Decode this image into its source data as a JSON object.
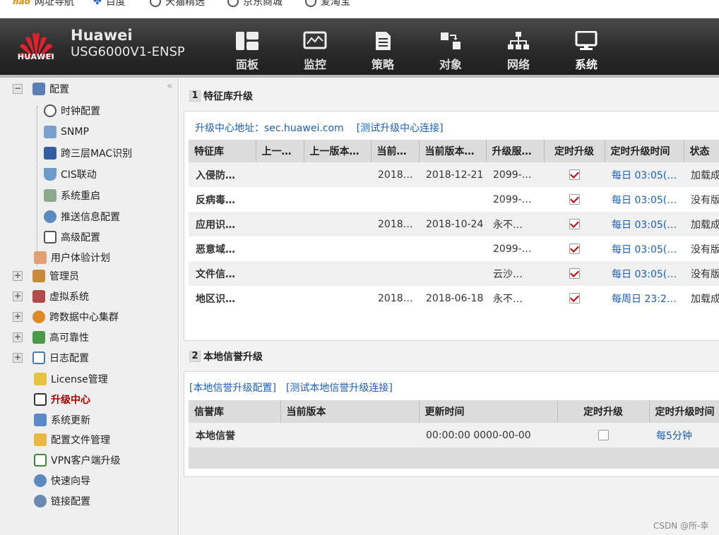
{
  "bookmarks": [
    "网址导航",
    "百度",
    "天猫精选",
    "京东商城",
    "爱淘宝"
  ],
  "header": {
    "logo_text": "HUAWEI",
    "brand": "Huawei",
    "model": "USG6000V1-ENSP",
    "nav": [
      {
        "label": "面板",
        "icon": "dashboard-icon"
      },
      {
        "label": "监控",
        "icon": "monitor-icon"
      },
      {
        "label": "策略",
        "icon": "policy-icon"
      },
      {
        "label": "对象",
        "icon": "object-icon"
      },
      {
        "label": "网络",
        "icon": "network-icon"
      },
      {
        "label": "系统",
        "icon": "system-icon",
        "active": true
      }
    ]
  },
  "sidebar": {
    "collapse_glyph": "«",
    "items": [
      {
        "label": "配置",
        "toggle": "−",
        "icon": "config-icon"
      },
      {
        "label": "时钟配置",
        "icon": "clock-icon"
      },
      {
        "label": "SNMP",
        "icon": "snmp-icon"
      },
      {
        "label": "跨三层MAC识别",
        "icon": "mac-icon"
      },
      {
        "label": "CIS联动",
        "icon": "cis-icon"
      },
      {
        "label": "系统重启",
        "icon": "restart-icon"
      },
      {
        "label": "推送信息配置",
        "icon": "push-icon"
      },
      {
        "label": "高级配置",
        "icon": "advanced-icon"
      },
      {
        "label": "用户体验计划",
        "icon": "ux-icon"
      },
      {
        "label": "管理员",
        "toggle": "+",
        "icon": "admin-icon"
      },
      {
        "label": "虚拟系统",
        "toggle": "+",
        "icon": "vsys-icon"
      },
      {
        "label": "跨数据中心集群",
        "toggle": "+",
        "icon": "cluster-icon"
      },
      {
        "label": "高可靠性",
        "toggle": "+",
        "icon": "ha-icon"
      },
      {
        "label": "日志配置",
        "toggle": "+",
        "icon": "log-icon"
      },
      {
        "label": "License管理",
        "icon": "license-icon"
      },
      {
        "label": "升级中心",
        "icon": "upgrade-icon",
        "active": true
      },
      {
        "label": "系统更新",
        "icon": "update-icon"
      },
      {
        "label": "配置文件管理",
        "icon": "file-icon"
      },
      {
        "label": "VPN客户端升级",
        "icon": "vpn-icon"
      },
      {
        "label": "快速向导",
        "icon": "wizard-icon"
      },
      {
        "label": "链接配置",
        "icon": "link-icon"
      }
    ]
  },
  "section1": {
    "num": "1",
    "title": "特征库升级",
    "center_label": "升级中心地址：sec.huawei.com",
    "test_link": "[测试升级中心连接]",
    "columns": [
      "特征库",
      "上一…",
      "上一版本…",
      "当前…",
      "当前版本…",
      "升级服…",
      "定时升级",
      "定时升级时间",
      "状态"
    ],
    "rows": [
      {
        "name": "入侵防…",
        "prev": "",
        "prev_date": "",
        "cur": "2018…",
        "cur_date": "2018-12-21",
        "svc": "2099-…",
        "sched": true,
        "time": "每日 03:05(…",
        "status": "加载成"
      },
      {
        "name": "反病毒…",
        "prev": "",
        "prev_date": "",
        "cur": "",
        "cur_date": "",
        "svc": "2099-…",
        "sched": true,
        "time": "每日 03:05(…",
        "status": "没有版"
      },
      {
        "name": "应用识…",
        "prev": "",
        "prev_date": "",
        "cur": "2018…",
        "cur_date": "2018-10-24",
        "svc": "永不…",
        "sched": true,
        "time": "每日 03:05(…",
        "status": "加载成"
      },
      {
        "name": "恶意域…",
        "prev": "",
        "prev_date": "",
        "cur": "",
        "cur_date": "",
        "svc": "2099-…",
        "sched": true,
        "time": "每日 03:05(…",
        "status": "没有版"
      },
      {
        "name": "文件信…",
        "prev": "",
        "prev_date": "",
        "cur": "",
        "cur_date": "",
        "svc": "云沙…",
        "sched": true,
        "time": "每日 03:05(…",
        "status": "没有版"
      },
      {
        "name": "地区识…",
        "prev": "",
        "prev_date": "",
        "cur": "2018…",
        "cur_date": "2018-06-18",
        "svc": "永不…",
        "sched": true,
        "time": "每周日 23:2…",
        "status": "加载成"
      }
    ]
  },
  "section2": {
    "num": "2",
    "title": "本地信誉升级",
    "link1": "[本地信誉升级配置]",
    "link2": "[测试本地信誉升级连接]",
    "columns": [
      "信誉库",
      "当前版本",
      "更新时间",
      "定时升级",
      "定时升级时间"
    ],
    "rows": [
      {
        "name": "本地信誉",
        "version": "",
        "updated": "00:00:00 0000-00-00",
        "sched": false,
        "time": "每5分钟"
      }
    ]
  },
  "watermark": "CSDN @所-幸",
  "colors": {
    "accent_link": "#1b5fb8",
    "active_menu": "#b00000",
    "status_ok": "#2b8a2b"
  }
}
